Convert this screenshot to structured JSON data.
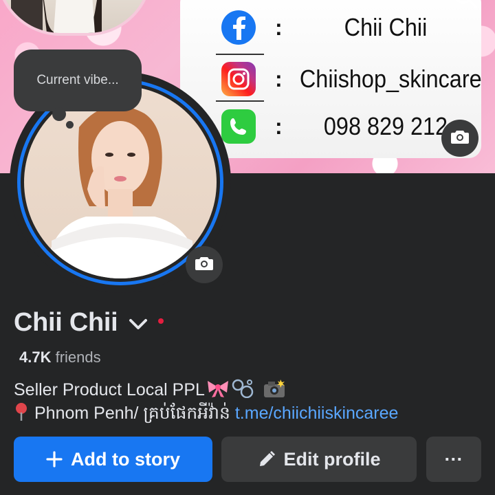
{
  "cover": {
    "rows": [
      {
        "icon": "facebook-icon",
        "text": "Chii Chii"
      },
      {
        "icon": "instagram-icon",
        "text": "Chiishop_skincare"
      },
      {
        "icon": "phone-icon",
        "text": "098 829 212"
      }
    ],
    "colon": ":"
  },
  "vibe": {
    "placeholder": "Current vibe..."
  },
  "profile": {
    "name": "Chii Chii",
    "friends_count": "4.7K",
    "friends_label": "friends",
    "bio_line_1": "Seller Product Local PPL",
    "bio_line_2_prefix": "Phnom Penh/ គ្រប់ផែកអីវ៉ាន់",
    "bio_link": "t.me/chiichiiskincaree"
  },
  "actions": {
    "add_story": "Add to story",
    "edit_profile": "Edit profile",
    "more": "···"
  },
  "colors": {
    "background": "#242526",
    "accent": "#1877f2",
    "button_secondary": "#3a3b3c",
    "link": "#5aa7ff",
    "status_dot": "#e41e3f"
  }
}
